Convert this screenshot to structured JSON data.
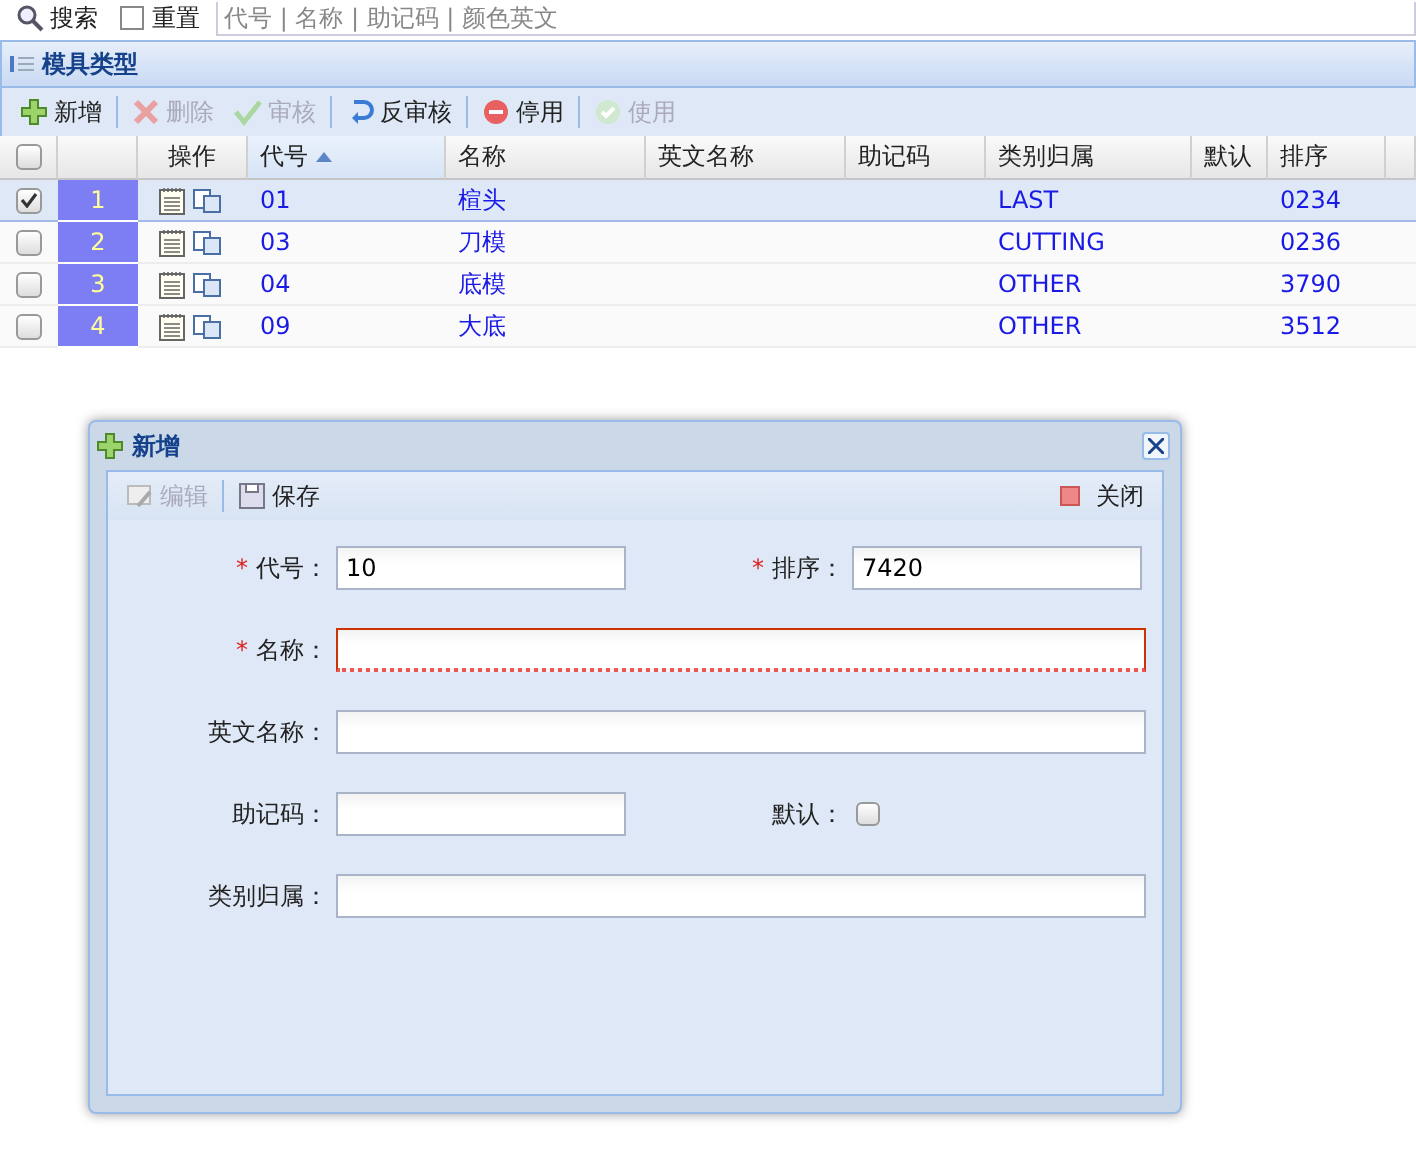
{
  "search_bar": {
    "buttons": [
      {
        "label": "搜索",
        "kind": "search"
      },
      {
        "label": "重置",
        "kind": "reset"
      }
    ],
    "placeholder": "代号 | 名称 | 助记码 | 颜色英文"
  },
  "panel": {
    "title": "模具类型"
  },
  "toolbar": [
    {
      "label": "新增",
      "kind": "add",
      "disabled": false
    },
    {
      "label": "删除",
      "kind": "delete",
      "disabled": true
    },
    {
      "label": "审核",
      "kind": "approve",
      "disabled": true
    },
    {
      "label": "反审核",
      "kind": "undo",
      "disabled": false
    },
    {
      "label": "停用",
      "kind": "stop",
      "disabled": false
    },
    {
      "label": "使用",
      "kind": "use",
      "disabled": true
    }
  ],
  "table": {
    "all_checked": false,
    "columns": [
      {
        "label": "操作",
        "sorted": false
      },
      {
        "label": "代号",
        "sorted": true
      },
      {
        "label": "名称",
        "sorted": false
      },
      {
        "label": "英文名称",
        "sorted": false
      },
      {
        "label": "助记码",
        "sorted": false
      },
      {
        "label": "类别归属",
        "sorted": false
      },
      {
        "label": "默认",
        "sorted": false
      },
      {
        "label": "排序",
        "sorted": false
      }
    ],
    "rows": [
      {
        "checked": true,
        "number": "1",
        "code": "01",
        "name": "楦头",
        "category": "LAST",
        "order": "0234"
      },
      {
        "checked": false,
        "number": "2",
        "code": "03",
        "name": "刀模",
        "category": "CUTTING",
        "order": "0236"
      },
      {
        "checked": false,
        "number": "3",
        "code": "04",
        "name": "底模",
        "category": "OTHER",
        "order": "3790"
      },
      {
        "checked": false,
        "number": "4",
        "code": "09",
        "name": "大底",
        "category": "OTHER",
        "order": "3512"
      }
    ]
  },
  "dialog": {
    "title": "新增",
    "toolbar": [
      {
        "label": "编辑",
        "kind": "edit",
        "disabled": true
      },
      {
        "label": "保存",
        "kind": "save",
        "disabled": false
      },
      {
        "label": "关闭",
        "kind": "close",
        "disabled": false
      }
    ],
    "rows": [
      {
        "fields": [
          {
            "kind": "short_text",
            "mark": "*",
            "label": "代号：",
            "value": "10",
            "invalid": false
          },
          {
            "kind": "short_text",
            "mark": "*",
            "label": "排序：",
            "value": "7420",
            "invalid": false
          }
        ]
      },
      {
        "fields": [
          {
            "kind": "long_text",
            "mark": "*",
            "label": "名称：",
            "invalid": true
          }
        ]
      },
      {
        "fields": [
          {
            "kind": "long_text",
            "label": "英文名称：",
            "invalid": false
          }
        ]
      },
      {
        "fields": [
          {
            "kind": "short_text",
            "label": "助记码：",
            "invalid": false
          },
          {
            "kind": "checkbox",
            "label": "默认：",
            "checked": false
          }
        ]
      },
      {
        "fields": [
          {
            "kind": "long_text",
            "label": "类别归属：",
            "invalid": false
          }
        ]
      }
    ]
  }
}
